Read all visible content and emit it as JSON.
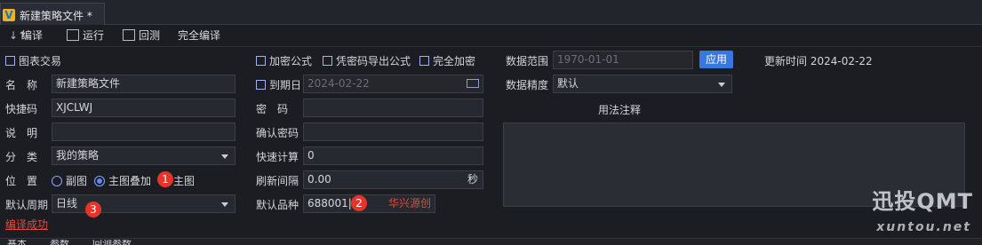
{
  "window": {
    "tab_title": "新建策略文件 *",
    "logo_letter": "V"
  },
  "toolbar": {
    "compile": "编译",
    "run": "运行",
    "backtest": "回测",
    "full_compile": "完全编译"
  },
  "form": {
    "chart_trade": "图表交易",
    "name_label": "名　称",
    "name_value": "新建策略文件",
    "shortcut_label": "快捷码",
    "shortcut_value": "XJCLWJ",
    "desc_label": "说　明",
    "desc_value": "",
    "category_label": "分　类",
    "category_value": "我的策略",
    "position_label": "位　置",
    "position_options": [
      "副图",
      "主图叠加",
      "主图"
    ],
    "period_label": "默认周期",
    "period_value": "日线",
    "compile_status": "编译成功",
    "encrypt": "加密公式",
    "export_encrypt": "凭密码导出公式",
    "full_encrypt": "完全加密",
    "expire_label": "到期日",
    "expire_value": "2024-02-22",
    "password_label": "密　码",
    "confirm_label": "确认密码",
    "quick_calc_label": "快速计算",
    "quick_calc_value": "0",
    "refresh_label": "刷新间隔",
    "refresh_value": "0.00",
    "refresh_unit": "秒",
    "default_symbol_label": "默认品种",
    "default_symbol_value": "688001|",
    "huaxing_source": "华兴源创",
    "data_range_label": "数据范围",
    "data_range_value": "1970-01-01",
    "apply": "应用",
    "update_label": "更新时间",
    "update_value": "2024-02-22",
    "precision_label": "数据精度",
    "precision_value": "默认",
    "notes_label": "用法注释"
  },
  "badges": [
    "1",
    "2",
    "3"
  ],
  "bottom_tabs": [
    "基本",
    "参数",
    "回测参数"
  ],
  "watermark": {
    "main": "迅投QMT",
    "url": "xuntou.net"
  },
  "colors": {
    "accent": "#3876e0",
    "badge": "#e8332a",
    "error_text": "#e24b3b",
    "background": "#1b1d23"
  }
}
